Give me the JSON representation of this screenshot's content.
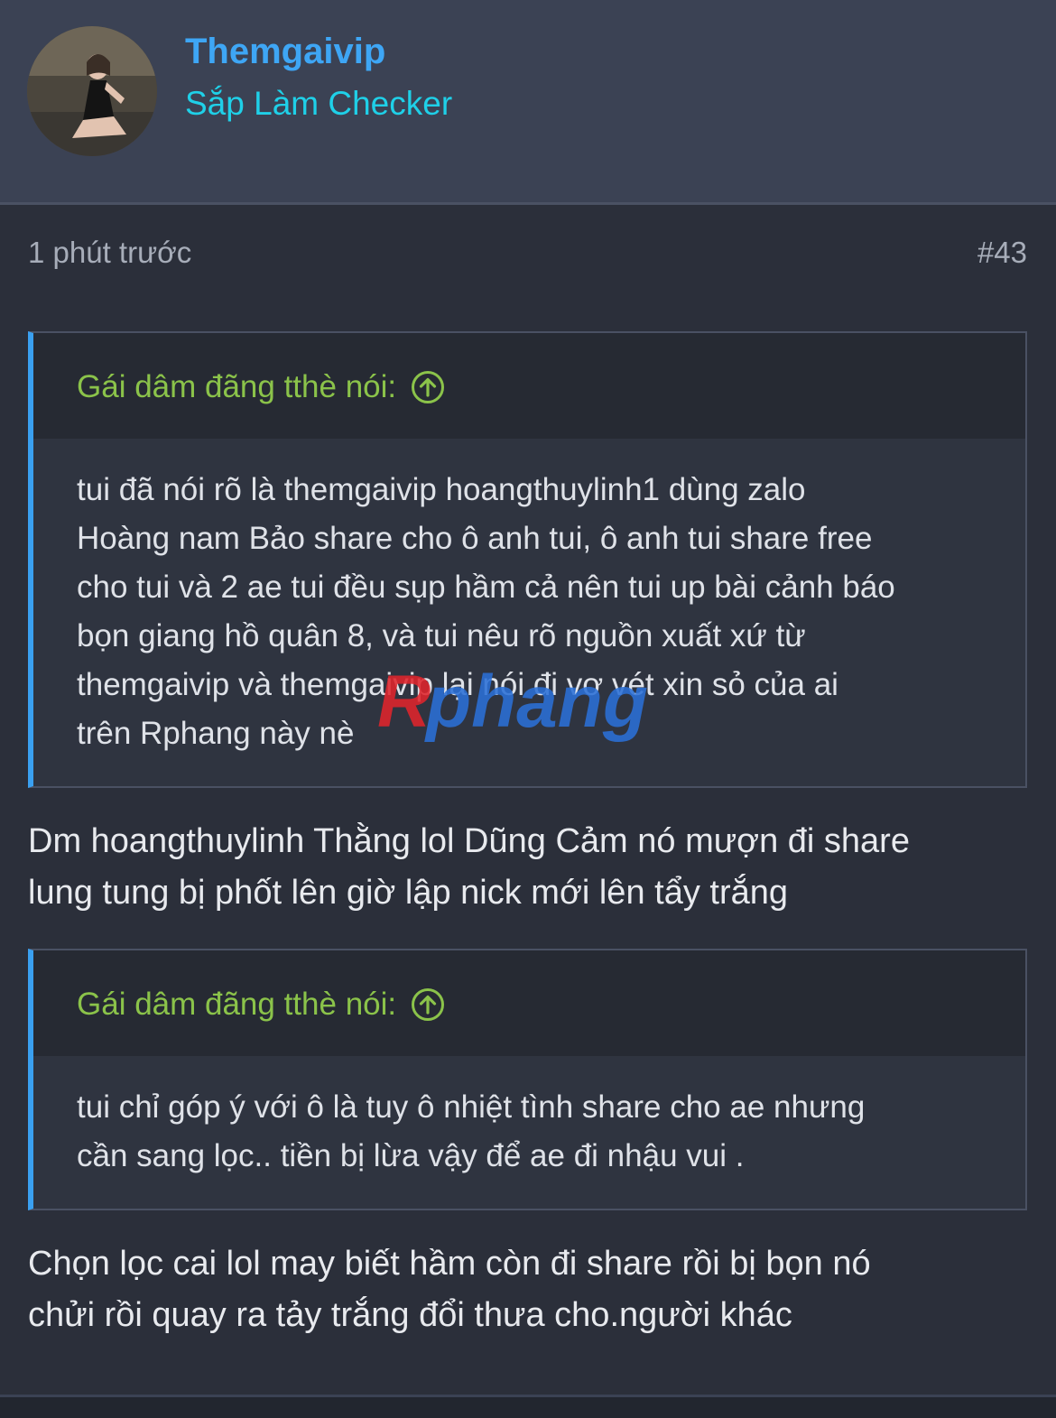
{
  "post": {
    "username": "Themgaivip",
    "user_title": "Sắp Làm Checker",
    "time": "1 phút trước",
    "number": "#43"
  },
  "quotes": [
    {
      "author": "Gái dâm đãng tthè nói:",
      "lines": [
        "tui đã nói rõ là themgaivip hoangthuylinh1 dùng zalo",
        "Hoàng nam Bảo share cho ô anh tui, ô anh tui share free",
        "cho tui và 2 ae tui đều sụp hầm cả nên tui up bài cảnh báo",
        "bọn giang hồ quân 8, và tui nêu rõ nguồn xuất xứ từ",
        "themgaivip và themgaivip lại nói đi vơ vét xin sỏ của ai",
        "trên Rphang này nè"
      ]
    },
    {
      "author": "Gái dâm đãng tthè nói:",
      "lines": [
        "tui chỉ góp ý với ô là tuy ô nhiệt tình share cho ae nhưng",
        "cần sang lọc.. tiền bị lừa vậy để ae đi nhậu vui ."
      ]
    }
  ],
  "replies": [
    {
      "lines": [
        "Dm hoangthuylinh Thằng lol Dũng Cảm nó mượn đi share",
        "lung tung bị phốt lên giờ lập nick mới lên tẩy trắng"
      ]
    },
    {
      "lines": [
        "Chọn lọc cai lol may biết hầm còn đi share rồi bị bọn nó",
        "chửi rồi quay ra tảy trắng đổi thưa cho.người khác"
      ]
    }
  ],
  "watermark": {
    "text": "Rphang",
    "colors": [
      "#e0242b",
      "#2b6fd6"
    ]
  },
  "icons": {
    "quote_jump": "arrow-up-circle-icon",
    "avatar": "user-avatar-photo"
  },
  "colors": {
    "username": "#3ea6f5",
    "user_title": "#1fd0e8",
    "quote_author": "#8bc34a",
    "quote_accent": "#3aa0f0",
    "background": "#2b2f3a"
  }
}
